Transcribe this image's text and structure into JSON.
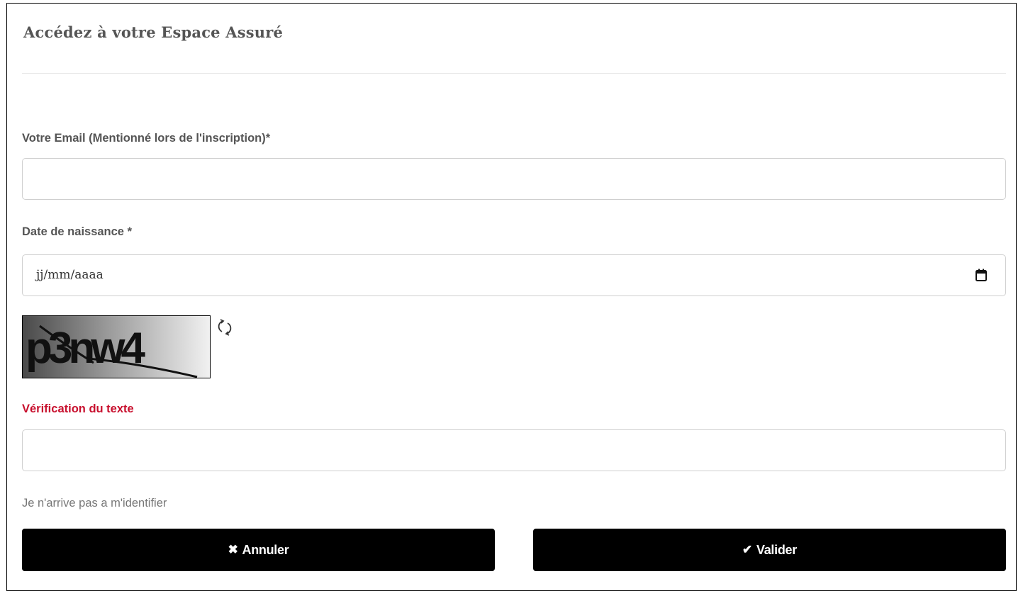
{
  "form": {
    "title": "Accédez à votre Espace Assuré",
    "email": {
      "label": "Votre Email (Mentionné lors de l'inscription)*",
      "value": ""
    },
    "birthdate": {
      "label": "Date de naissance *",
      "placeholder": "jj/mm/aaaa"
    },
    "captcha": {
      "text": "p3nw4",
      "refresh_icon": "refresh-icon"
    },
    "verification": {
      "label": "Vérification du texte",
      "value": ""
    },
    "help_link": "Je n'arrive pas a m'identifier",
    "buttons": {
      "cancel": {
        "icon": "✖",
        "label": "Annuler"
      },
      "submit": {
        "icon": "✔",
        "label": "Valider"
      }
    }
  },
  "colors": {
    "text": "#555555",
    "accent_red": "#c8102e",
    "button_bg": "#000000",
    "button_text": "#ffffff",
    "input_border": "#cfcfcf"
  }
}
